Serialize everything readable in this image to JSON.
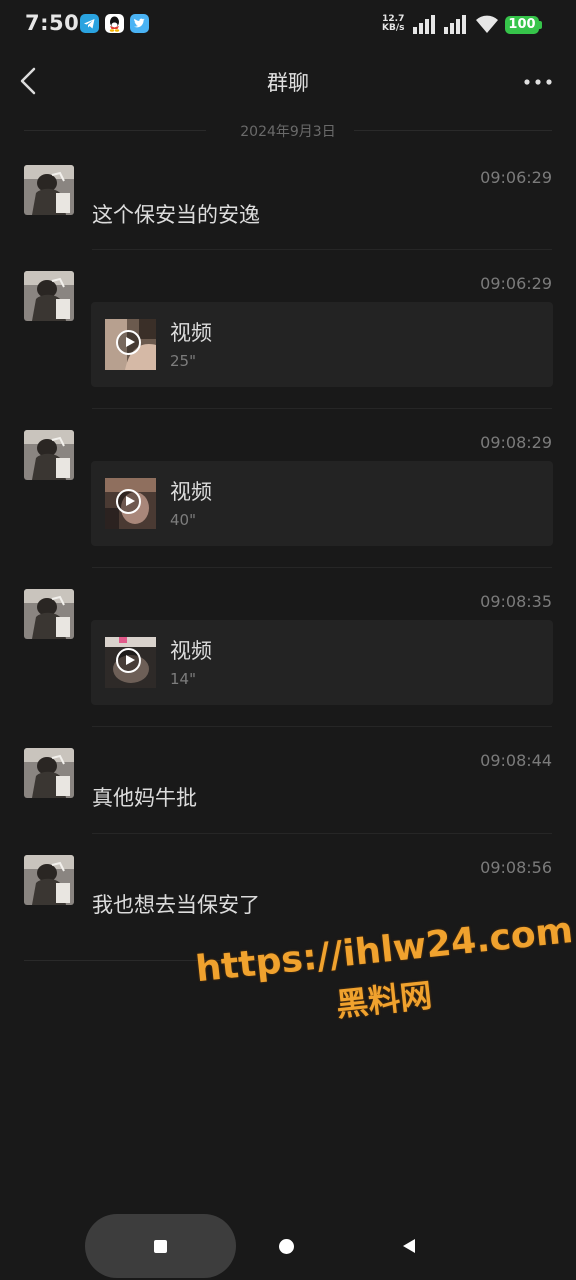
{
  "status": {
    "time": "7:50",
    "net_speed_value": "12.7",
    "net_speed_unit": "KB/s",
    "battery": "100",
    "app_icons": [
      "telegram-icon",
      "qq-icon",
      "twitter-icon"
    ]
  },
  "nav": {
    "title": "群聊"
  },
  "date_separator": "2024年9月3日",
  "messages": [
    {
      "time": "09:06:29",
      "type": "text",
      "text": "这个保安当的安逸"
    },
    {
      "time": "09:06:29",
      "type": "video",
      "title": "视频",
      "duration": "25\""
    },
    {
      "time": "09:08:29",
      "type": "video",
      "title": "视频",
      "duration": "40\""
    },
    {
      "time": "09:08:35",
      "type": "video",
      "title": "视频",
      "duration": "14\""
    },
    {
      "time": "09:08:44",
      "type": "text",
      "text": "真他妈牛批"
    },
    {
      "time": "09:08:56",
      "type": "text",
      "text": "我也想去当保安了"
    }
  ],
  "watermark": {
    "url": "https://ihlw24.com",
    "name": "黑料网"
  },
  "colors": {
    "background": "#191919",
    "card": "#232323",
    "battery": "#36c44a",
    "watermark": "#f0a22e"
  }
}
